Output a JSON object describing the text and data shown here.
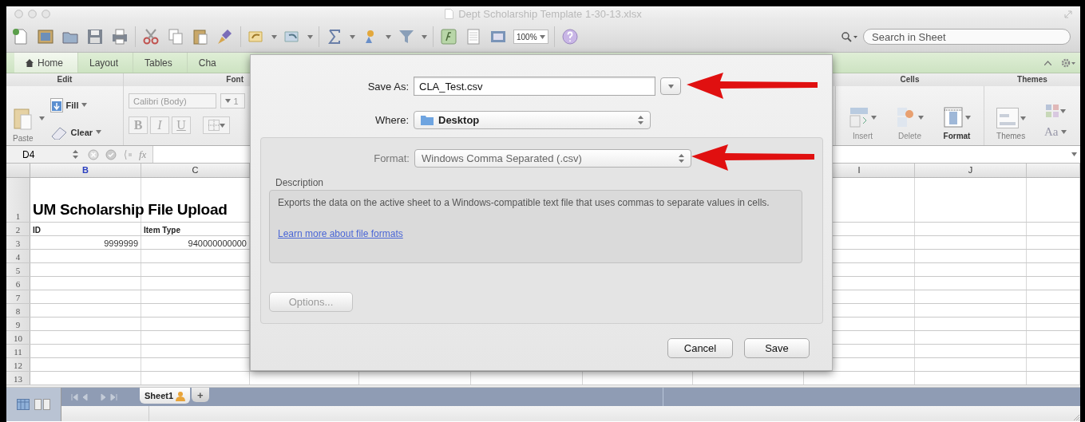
{
  "window": {
    "title": "Dept Scholarship Template 1-30-13.xlsx"
  },
  "toolbar": {
    "zoom": "100%",
    "search": {
      "placeholder": "Search in Sheet"
    }
  },
  "ribbon": {
    "tabs": [
      {
        "label": "Home",
        "selected": true
      },
      {
        "label": "Layout",
        "selected": false
      },
      {
        "label": "Tables",
        "selected": false
      },
      {
        "label": "Cha",
        "selected": false
      }
    ],
    "edit_group": {
      "title": "Edit",
      "paste": "Paste",
      "fill": "Fill",
      "clear": "Clear"
    },
    "font_group": {
      "title": "Font",
      "font": "Calibri (Body)",
      "size": "1",
      "styles": [
        "B",
        "I",
        "U"
      ]
    },
    "cells_group": {
      "title": "Cells",
      "items": [
        {
          "label": "Insert",
          "disabled": true
        },
        {
          "label": "Delete",
          "disabled": true
        },
        {
          "label": "Format",
          "disabled": false
        }
      ]
    },
    "themes_group": {
      "title": "Themes",
      "themes": "Themes",
      "fonts": "Aa"
    }
  },
  "formula_bar": {
    "cell_ref": "D4",
    "function_label": "fx"
  },
  "grid": {
    "columns": [
      {
        "label": "B",
        "selected": true
      },
      {
        "label": "C",
        "selected": false
      },
      {
        "label": "I",
        "selected": false
      },
      {
        "label": "J",
        "selected": false
      }
    ],
    "rows": [
      {
        "number": "1",
        "kind": "title",
        "cells": [
          "UM Scholarship File Upload"
        ]
      },
      {
        "number": "2",
        "kind": "header",
        "cells": [
          "ID",
          "Item Type"
        ]
      },
      {
        "number": "3",
        "kind": "number",
        "cells": [
          "9999999",
          "940000000000"
        ]
      },
      {
        "number": "4"
      },
      {
        "number": "5"
      },
      {
        "number": "6"
      },
      {
        "number": "7"
      },
      {
        "number": "8"
      },
      {
        "number": "9"
      },
      {
        "number": "10"
      },
      {
        "number": "11"
      },
      {
        "number": "12"
      },
      {
        "number": "13"
      }
    ]
  },
  "sheet_tabs": [
    {
      "label": "Sheet1",
      "selected": true
    }
  ],
  "add_sheet": "+",
  "dialog": {
    "save_as": {
      "label": "Save As:",
      "value": "CLA_Test.csv"
    },
    "where": {
      "label": "Where:",
      "value": "Desktop"
    },
    "format": {
      "label": "Format:",
      "value": "Windows Comma Separated (.csv)"
    },
    "description": {
      "label": "Description",
      "text": "Exports the data on the active sheet to a Windows-compatible text file that uses commas to separate values in cells.",
      "link": "Learn more about file formats"
    },
    "buttons": [
      {
        "kind": "options",
        "label": "Options...",
        "disabled": true
      },
      {
        "kind": "cancel",
        "label": "Cancel",
        "disabled": false
      },
      {
        "kind": "save",
        "label": "Save",
        "disabled": false
      }
    ]
  }
}
